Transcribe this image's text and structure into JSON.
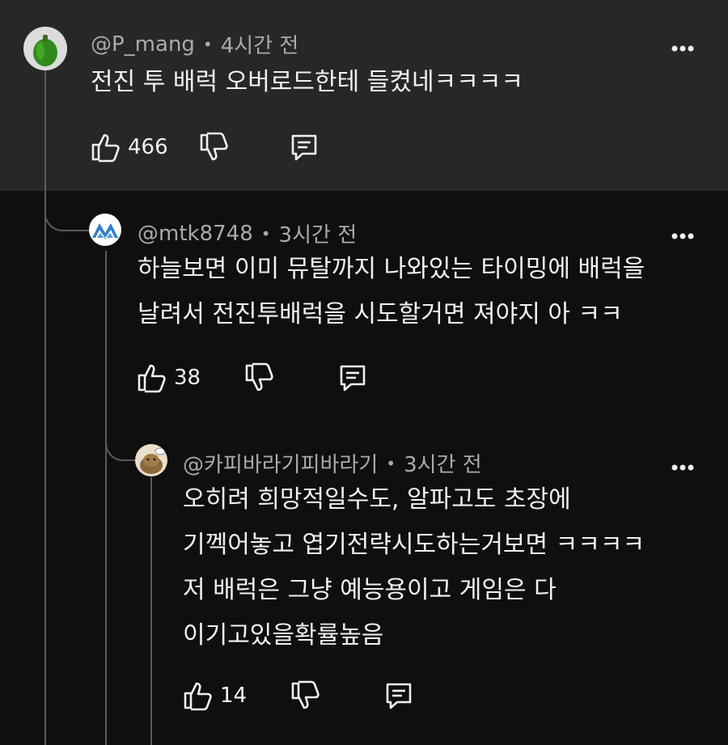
{
  "comments": [
    {
      "author": "@P_mang",
      "time": "4시간 전",
      "lines": [
        "전진 투 배럭 오버로드한테 들켰네ㅋㅋㅋㅋ"
      ],
      "likes": "466"
    },
    {
      "author": "@mtk8748",
      "time": "3시간 전",
      "lines": [
        "하늘보면 이미 뮤탈까지 나와있는 타이밍에 배럭을",
        "날려서 전진투배럭을 시도할거면 져야지 아 ㅋㅋ"
      ],
      "likes": "38"
    },
    {
      "author": "@카피바라기피바라기",
      "time": "3시간 전",
      "lines": [
        "오히려 희망적일수도, 알파고도 초장에",
        "기껙어놓고 엽기전략시도하는거보면 ㅋㅋㅋㅋ",
        "저 배럭은 그냥 예능용이고 게임은 다",
        "이기고있을확률높음"
      ],
      "likes": "14"
    }
  ],
  "separator": "•",
  "icons": {
    "like": "thumbs-up-icon",
    "dislike": "thumbs-down-icon",
    "reply": "reply-comment-icon",
    "more": "more-vertical-icon"
  },
  "colors": {
    "background": "#0f0f0f",
    "highlight": "#272727",
    "text": "#f1f1f1",
    "meta": "#aaaaaa"
  }
}
